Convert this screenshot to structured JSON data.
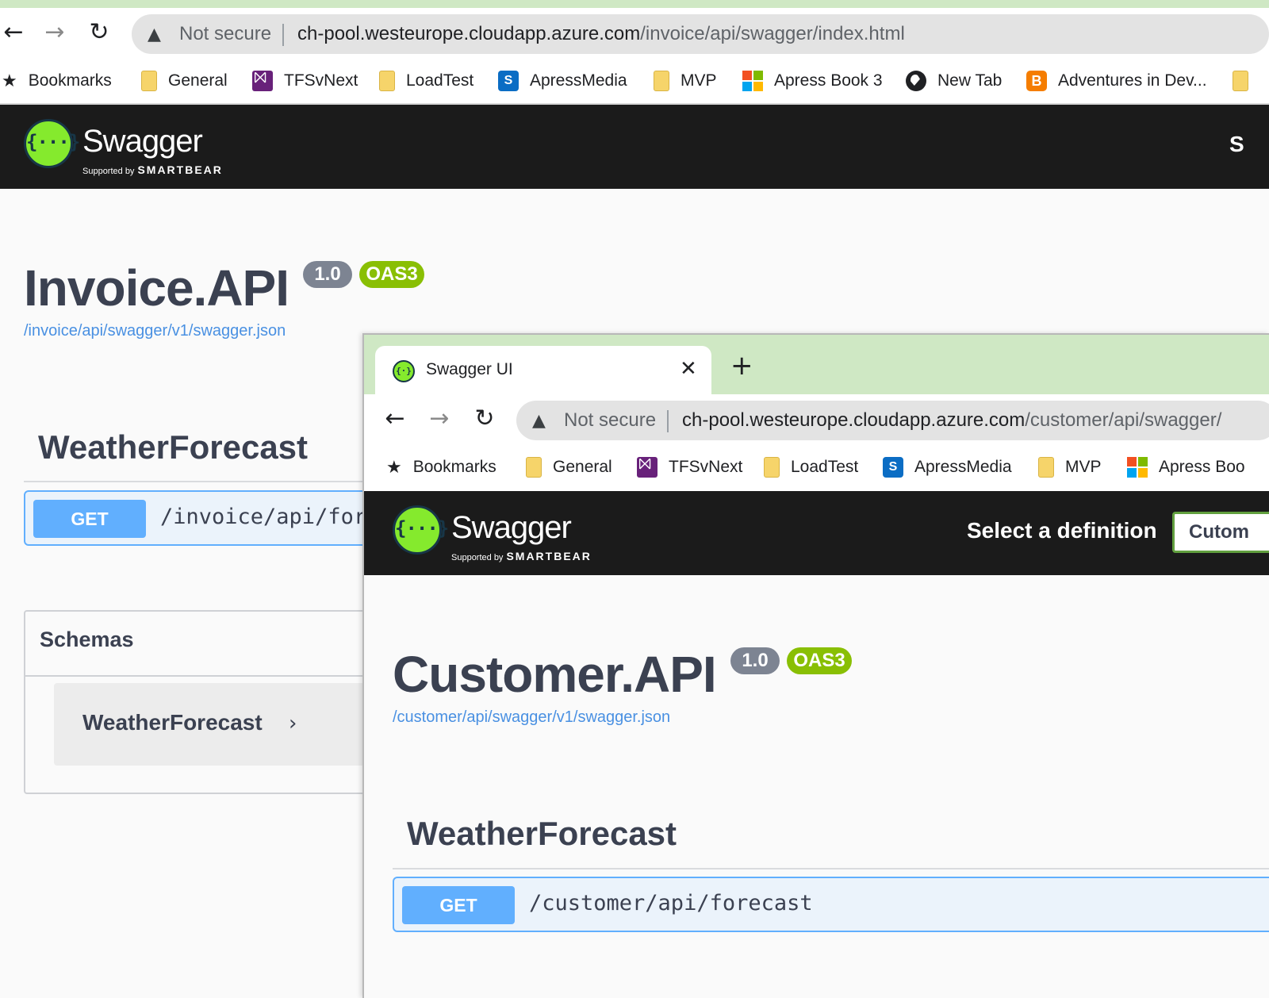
{
  "back": {
    "browser": {
      "not_secure": "Not secure",
      "url_host": "ch-pool.westeurope.cloudapp.azure.com",
      "url_path": "/invoice/api/swagger/index.html"
    },
    "header": {
      "brand": "Swagger",
      "supported_by": "Supported by",
      "smartbear": "SMARTBEAR",
      "right_text": "S"
    },
    "api": {
      "title": "Invoice.API",
      "version": "1.0",
      "oas": "OAS3",
      "json_link": "/invoice/api/swagger/v1/swagger.json"
    },
    "tag": "WeatherForecast",
    "operation": {
      "method": "GET",
      "path": "/invoice/api/forecast"
    },
    "schemas": {
      "title": "Schemas",
      "items": [
        "WeatherForecast"
      ]
    }
  },
  "bookmarks": {
    "label": "Bookmarks",
    "items": [
      {
        "label": "General",
        "icon": "folder-icon"
      },
      {
        "label": "TFSvNext",
        "icon": "visual-studio-icon"
      },
      {
        "label": "LoadTest",
        "icon": "folder-icon"
      },
      {
        "label": "ApressMedia",
        "icon": "sharepoint-icon"
      },
      {
        "label": "MVP",
        "icon": "folder-icon"
      },
      {
        "label": "Apress Book 3",
        "icon": "microsoft-icon"
      },
      {
        "label": "New Tab",
        "icon": "globe-icon"
      },
      {
        "label": "Adventures in Dev...",
        "icon": "blogger-icon"
      }
    ]
  },
  "front": {
    "tab": {
      "title": "Swagger UI"
    },
    "browser": {
      "not_secure": "Not secure",
      "url_host": "ch-pool.westeurope.cloudapp.azure.com",
      "url_path": "/customer/api/swagger/"
    },
    "bookmarks_partial_last": "Apress Boo",
    "header": {
      "brand": "Swagger",
      "supported_by": "Supported by",
      "smartbear": "SMARTBEAR",
      "select_label": "Select a definition",
      "select_value": "Cutom"
    },
    "api": {
      "title": "Customer.API",
      "version": "1.0",
      "oas": "OAS3",
      "json_link": "/customer/api/swagger/v1/swagger.json"
    },
    "tag": "WeatherForecast",
    "operation": {
      "method": "GET",
      "path": "/customer/api/forecast"
    }
  },
  "colors": {
    "swagger_green": "#85ea2d",
    "get_blue": "#61affe",
    "badge_grey": "#7d8492",
    "badge_green": "#89bf04",
    "chrome_green": "#cfe8c4",
    "header_black": "#1b1b1b"
  }
}
